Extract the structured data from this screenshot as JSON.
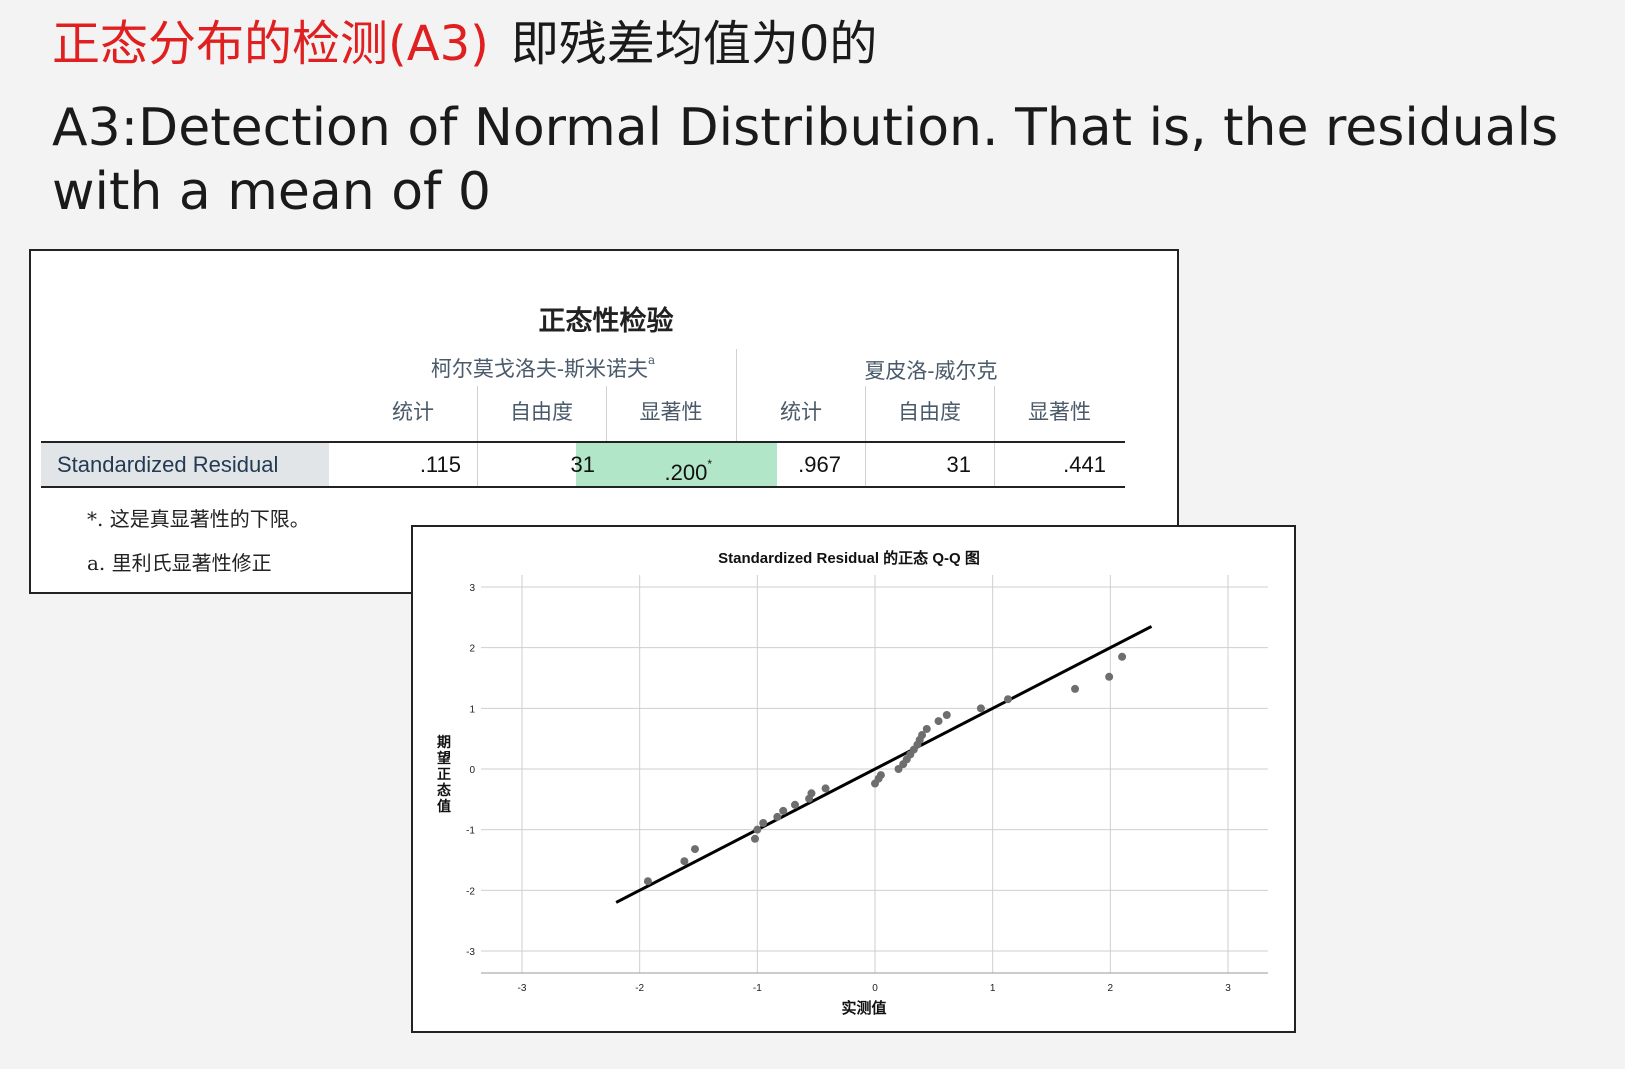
{
  "slide": {
    "title_red": "正态分布的检测(A3)",
    "title_black": "即残差均值为0的",
    "subtitle": "A3:Detection of Normal Distribution. That is, the residuals with a mean of 0"
  },
  "table": {
    "title": "正态性检验",
    "group1": "柯尔莫戈洛夫-斯米诺夫",
    "group1_sup": "a",
    "group2": "夏皮洛-威尔克",
    "col_headers": [
      "统计",
      "自由度",
      "显著性",
      "统计",
      "自由度",
      "显著性"
    ],
    "row_label": "Standardized Residual",
    "row_values": [
      ".115",
      "31",
      ".200",
      ".967",
      "31",
      ".441"
    ],
    "sig_sup": "*",
    "note1": "*. 这是真显著性的下限。",
    "note2": "a. 里利氏显著性修正"
  },
  "colors": {
    "highlight": "#b2e6c8",
    "title_red": "#e02020",
    "point": "#6e6e6e",
    "line": "#000000"
  },
  "chart_data": {
    "type": "scatter",
    "title": "Standardized Residual 的正态 Q-Q 图",
    "xlabel": "实测值",
    "ylabel": "期望正态值",
    "xlim": [
      -3,
      3
    ],
    "ylim": [
      -3,
      3
    ],
    "xticks": [
      "-3",
      "-2",
      "-1",
      "0",
      "1",
      "2",
      "3"
    ],
    "yticks": [
      "-3",
      "-2",
      "-1",
      "0",
      "1",
      "2",
      "3"
    ],
    "grid": true,
    "reference_line": {
      "x": [
        -2.2,
        2.35
      ],
      "y": [
        -2.2,
        2.35
      ]
    },
    "points": {
      "x": [
        -1.93,
        -1.62,
        -1.53,
        -1.02,
        -1.0,
        -0.95,
        -0.83,
        -0.78,
        -0.68,
        -0.56,
        -0.54,
        -0.42,
        0.0,
        0.03,
        0.05,
        0.2,
        0.24,
        0.27,
        0.3,
        0.33,
        0.36,
        0.38,
        0.4,
        0.44,
        0.54,
        0.61,
        0.9,
        1.13,
        1.7,
        1.99,
        2.1
      ],
      "y": [
        -1.85,
        -1.52,
        -1.32,
        -1.15,
        -1.0,
        -0.89,
        -0.79,
        -0.69,
        -0.59,
        -0.49,
        -0.4,
        -0.32,
        -0.24,
        -0.16,
        -0.1,
        0.0,
        0.08,
        0.16,
        0.24,
        0.32,
        0.4,
        0.48,
        0.56,
        0.66,
        0.79,
        0.89,
        1.0,
        1.15,
        1.32,
        1.52,
        1.85
      ]
    }
  }
}
